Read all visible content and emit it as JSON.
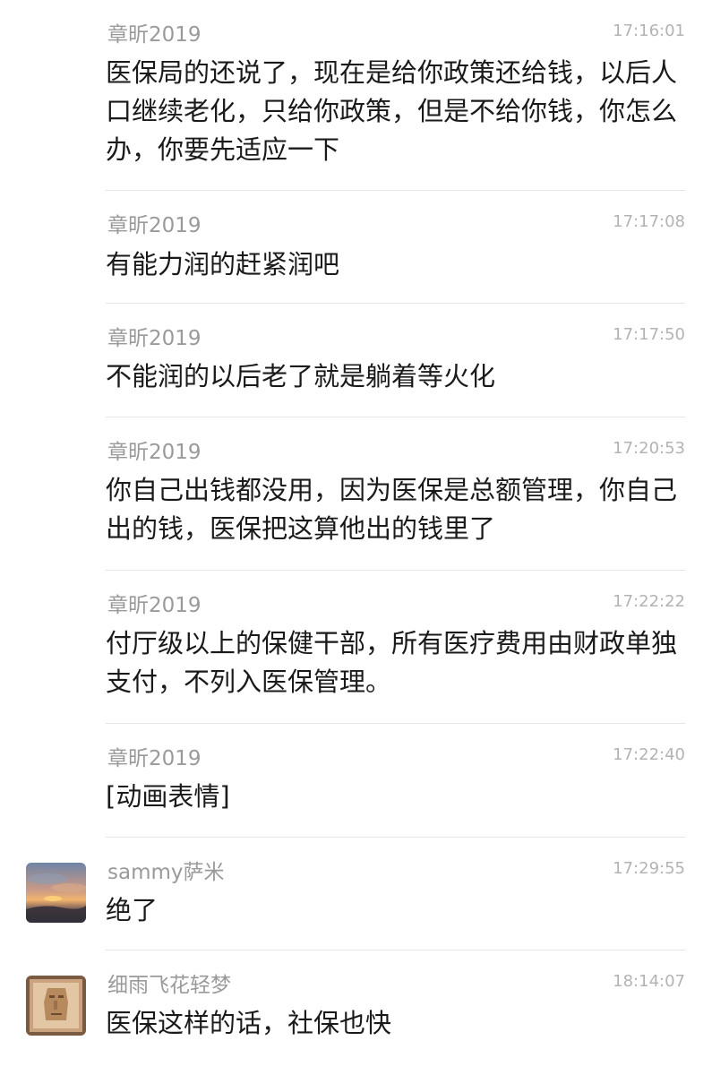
{
  "messages": [
    {
      "sender": "章昕2019",
      "time": "17:16:01",
      "text": "医保局的还说了，现在是给你政策还给钱，以后人口继续老化，只给你政策，但是不给你钱，你怎么办，你要先适应一下"
    },
    {
      "sender": "章昕2019",
      "time": "17:17:08",
      "text": "有能力润的赶紧润吧"
    },
    {
      "sender": "章昕2019",
      "time": "17:17:50",
      "text": "不能润的以后老了就是躺着等火化"
    },
    {
      "sender": "章昕2019",
      "time": "17:20:53",
      "text": "你自己出钱都没用，因为医保是总额管理，你自己出的钱，医保把这算他出的钱里了"
    },
    {
      "sender": "章昕2019",
      "time": "17:22:22",
      "text": "付厅级以上的保健干部，所有医疗费用由财政单独支付，不列入医保管理。"
    },
    {
      "sender": "章昕2019",
      "time": "17:22:40",
      "text": "[动画表情]"
    },
    {
      "sender": "sammy萨米",
      "time": "17:29:55",
      "text": "绝了"
    },
    {
      "sender": "细雨飞花轻梦",
      "time": "18:14:07",
      "text": "医保这样的话，社保也快"
    }
  ]
}
